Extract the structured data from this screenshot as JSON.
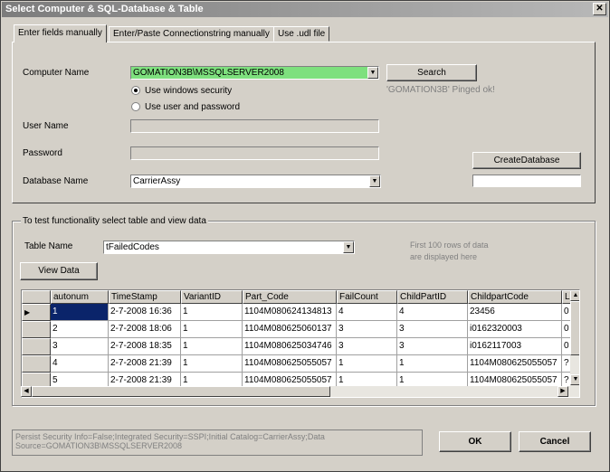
{
  "window": {
    "title": "Select Computer & SQL-Database & Table",
    "close_glyph": "✕"
  },
  "tabs": [
    {
      "label": "Enter fields manually",
      "active": true
    },
    {
      "label": "Enter/Paste Connectionstring manually",
      "active": false
    },
    {
      "label": "Use .udl file",
      "active": false
    }
  ],
  "form": {
    "computer_name_label": "Computer Name",
    "computer_name_value": "GOMATION3B\\MSSQLSERVER2008",
    "search_button": "Search",
    "ping_status": "'GOMATION3B' Pinged ok!",
    "radio_windows": "Use windows security",
    "radio_user": "Use user and password",
    "user_name_label": "User Name",
    "user_name_value": "",
    "password_label": "Password",
    "password_value": "",
    "database_name_label": "Database Name",
    "database_name_value": "CarrierAssy",
    "create_database_button": "CreateDatabase",
    "create_database_value": ""
  },
  "test_group": {
    "title": "To test functionality select table and view data",
    "table_name_label": "Table Name",
    "table_name_value": "tFailedCodes",
    "view_data_button": "View Data",
    "hint": "First 100 rows of data are displayed here"
  },
  "grid": {
    "columns": [
      "autonum",
      "TimeStamp",
      "VariantID",
      "Part_Code",
      "FailCount",
      "ChildPartID",
      "ChildpartCode",
      "L"
    ],
    "rows": [
      [
        "1",
        "2-7-2008 16:36",
        "1",
        "1104M080624134813",
        "4",
        "4",
        "23456",
        "0"
      ],
      [
        "2",
        "2-7-2008 18:06",
        "1",
        "1104M080625060137",
        "3",
        "3",
        "i0162320003",
        "0"
      ],
      [
        "3",
        "2-7-2008 18:35",
        "1",
        "1104M080625034746",
        "3",
        "3",
        "i0162117003",
        "0"
      ],
      [
        "4",
        "2-7-2008 21:39",
        "1",
        "1104M080625055057",
        "1",
        "1",
        "1104M080625055057",
        "?"
      ],
      [
        "5",
        "2-7-2008 21:39",
        "1",
        "1104M080625055057",
        "1",
        "1",
        "1104M080625055057",
        "?"
      ]
    ],
    "current_row_marker": "▶"
  },
  "footer": {
    "connection_string": "Persist Security Info=False;Integrated Security=SSPI;Initial Catalog=CarrierAssy;Data Source=GOMATION3B\\MSSQLSERVER2008",
    "ok_button": "OK",
    "cancel_button": "Cancel"
  },
  "colors": {
    "computer_name_bg": "#7ee07e",
    "selection": "#0a246a"
  }
}
